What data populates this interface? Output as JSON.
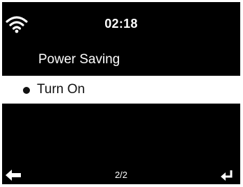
{
  "status": {
    "time": "02:18",
    "wifi_icon": "wifi-icon"
  },
  "menu": {
    "title": "Power Saving",
    "items": [
      {
        "label": "Turn On",
        "selected": true
      }
    ]
  },
  "footer": {
    "page_indicator": "2/2",
    "back_icon": "back-arrow-icon",
    "enter_icon": "enter-icon"
  },
  "colors": {
    "background": "#000000",
    "text": "#ffffff",
    "highlight": "#ffffff",
    "highlight_text": "#111111"
  }
}
